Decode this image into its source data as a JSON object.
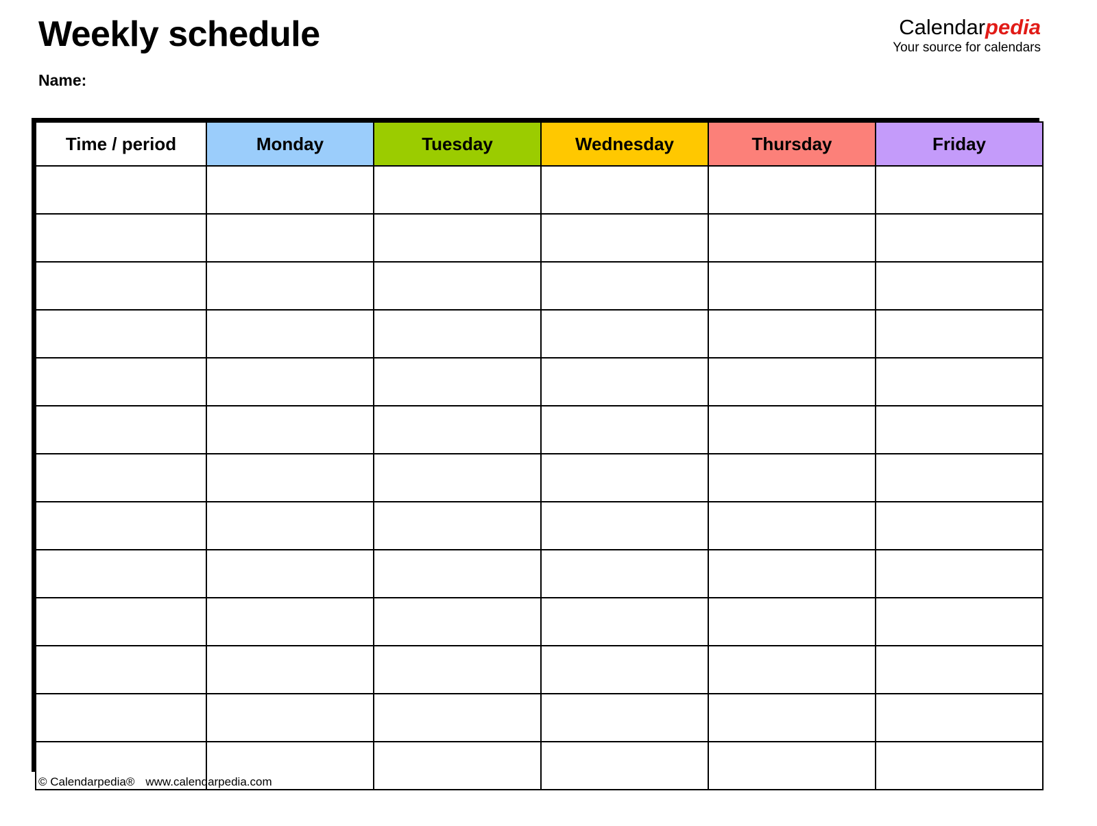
{
  "document": {
    "title": "Weekly schedule",
    "name_label": "Name:"
  },
  "brand": {
    "name_part1": "Calendar",
    "name_part2": "pedia",
    "tagline": "Your source for calendars",
    "accent_color": "#e11b17"
  },
  "schedule": {
    "columns": [
      {
        "label": "Time / period",
        "color": "#ffffff",
        "kind": "time"
      },
      {
        "label": "Monday",
        "color": "#9bcdfb",
        "kind": "day"
      },
      {
        "label": "Tuesday",
        "color": "#9bcc00",
        "kind": "day"
      },
      {
        "label": "Wednesday",
        "color": "#ffc800",
        "kind": "day"
      },
      {
        "label": "Thursday",
        "color": "#fc8079",
        "kind": "day"
      },
      {
        "label": "Friday",
        "color": "#c49bfa",
        "kind": "day"
      }
    ],
    "row_count": 13,
    "rows": [
      [
        "",
        "",
        "",
        "",
        "",
        ""
      ],
      [
        "",
        "",
        "",
        "",
        "",
        ""
      ],
      [
        "",
        "",
        "",
        "",
        "",
        ""
      ],
      [
        "",
        "",
        "",
        "",
        "",
        ""
      ],
      [
        "",
        "",
        "",
        "",
        "",
        ""
      ],
      [
        "",
        "",
        "",
        "",
        "",
        ""
      ],
      [
        "",
        "",
        "",
        "",
        "",
        ""
      ],
      [
        "",
        "",
        "",
        "",
        "",
        ""
      ],
      [
        "",
        "",
        "",
        "",
        "",
        ""
      ],
      [
        "",
        "",
        "",
        "",
        "",
        ""
      ],
      [
        "",
        "",
        "",
        "",
        "",
        ""
      ],
      [
        "",
        "",
        "",
        "",
        "",
        ""
      ],
      [
        "",
        "",
        "",
        "",
        "",
        ""
      ]
    ]
  },
  "footer": {
    "copyright": "© Calendarpedia®",
    "website": "www.calendarpedia.com"
  }
}
